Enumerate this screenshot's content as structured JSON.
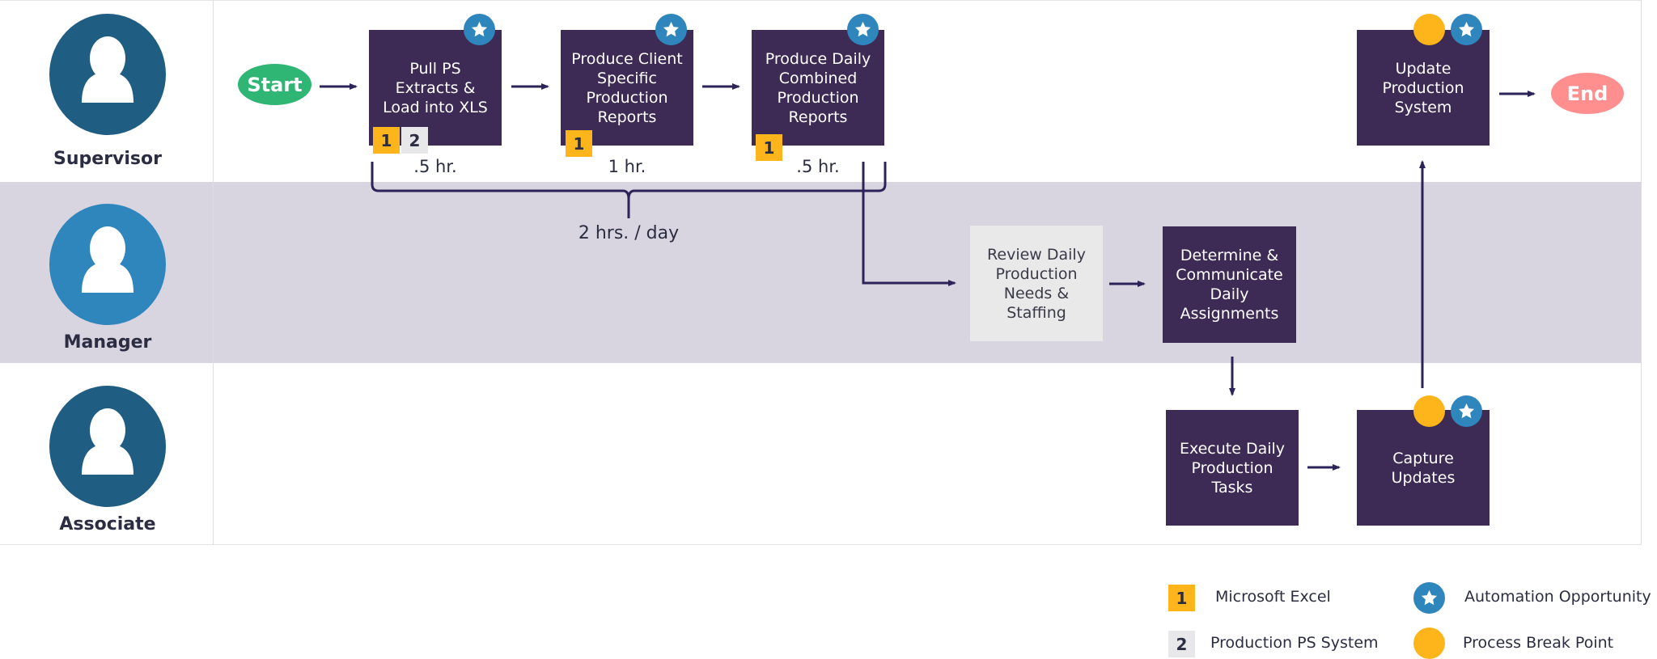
{
  "roles": [
    {
      "label": "Supervisor",
      "color": "#1f5d82"
    },
    {
      "label": "Manager",
      "color": "#2e86bd"
    },
    {
      "label": "Associate",
      "color": "#1f5d82"
    }
  ],
  "start_label": "Start",
  "end_label": "End",
  "steps": {
    "pull_ps": {
      "label": "Pull PS Extracts & Load into XLS",
      "time": ".5 hr.",
      "systems": [
        "1",
        "2"
      ],
      "automation": true,
      "break_point": false
    },
    "client_reports": {
      "label": "Produce Client Specific Production Reports",
      "time": "1 hr.",
      "systems": [
        "1"
      ],
      "automation": true,
      "break_point": false
    },
    "combined_reports": {
      "label": "Produce Daily Combined Production Reports",
      "time": ".5 hr.",
      "systems": [
        "1"
      ],
      "automation": true,
      "break_point": false
    },
    "review": {
      "label": "Review Daily Production Needs & Staffing",
      "automation": false,
      "break_point": false
    },
    "determine": {
      "label": "Determine & Communicate Daily Assignments",
      "automation": false,
      "break_point": false
    },
    "execute": {
      "label": "Execute Daily Production Tasks",
      "automation": false,
      "break_point": false
    },
    "capture": {
      "label": "Capture Updates",
      "automation": true,
      "break_point": true
    },
    "update": {
      "label": "Update Production System",
      "automation": true,
      "break_point": true
    }
  },
  "total_time": "2 hrs. / day",
  "legend": {
    "excel": {
      "key": "1",
      "label": "Microsoft Excel"
    },
    "ps_system": {
      "key": "2",
      "label": "Production PS System"
    },
    "automation": {
      "label": "Automation Opportunity",
      "icon": "star-icon"
    },
    "break_point": {
      "label": "Process Break Point",
      "icon": "circle-icon"
    }
  },
  "colors": {
    "step": "#3d2b56",
    "review_step": "#e9e9ea",
    "start": "#2fb574",
    "end": "#ff8f8f",
    "automation": "#2e86bd",
    "break_point": "#fdb51b",
    "excel": "#fdb51b",
    "ps_system": "#e8e8ea",
    "lane_alt": "#d8d5e0"
  }
}
